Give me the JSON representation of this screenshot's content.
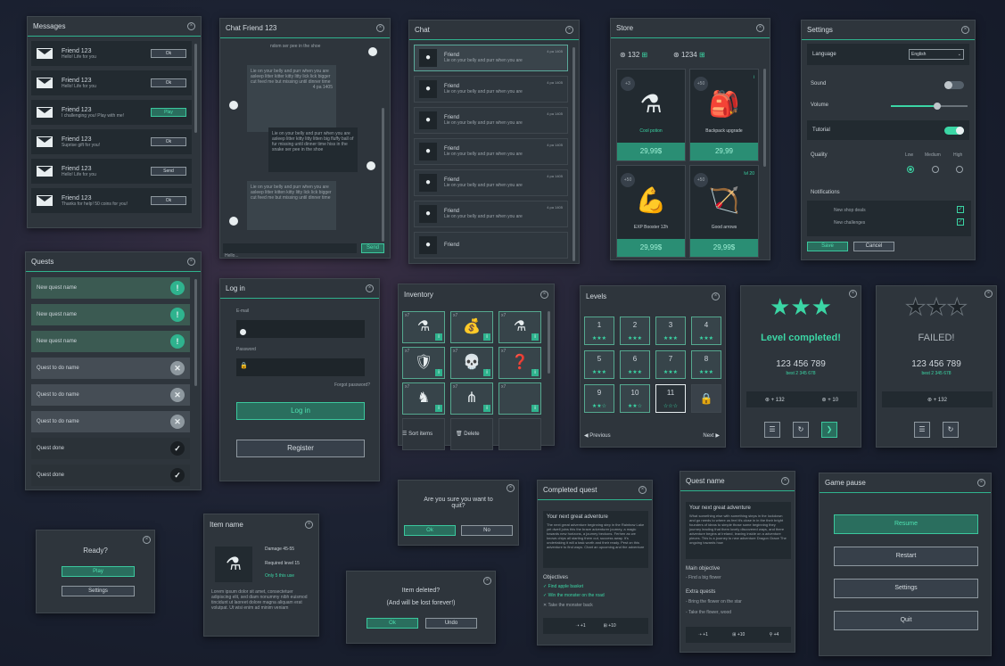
{
  "messages": {
    "title": "Messages",
    "items": [
      {
        "name": "Friend 123",
        "text": "Hello! Life for you",
        "btn": "Ok",
        "active": false
      },
      {
        "name": "Friend 123",
        "text": "Hello! Life for you",
        "btn": "Ok",
        "active": false
      },
      {
        "name": "Friend 123",
        "text": "I challenging you! Play with me!",
        "btn": "Play",
        "active": true
      },
      {
        "name": "Friend 123",
        "text": "Suprise gift for you!",
        "btn": "Ok",
        "active": false
      },
      {
        "name": "Friend 123",
        "text": "Hello! Life for you",
        "btn": "Send",
        "active": false
      },
      {
        "name": "Friend 123",
        "text": "Thanks for help! 50 coins for you!",
        "btn": "Ok",
        "active": false
      }
    ]
  },
  "chat_friend": {
    "title": "Chat Friend 123",
    "top": "ndom ser pee in the shoe",
    "b1": "Lie on your belly and purr when you are asleep litter kitter kitty litty lick lick bigger cut feed me but missing until dinner time",
    "b2": "Lie on your belly and purr when you are asleep litter kitty litty litten big fluffy ball of fur missing until dinner time hiss in the snake ser pee in the shoe",
    "b3": "Lie on your belly and purr when you are asleep litter kitten kitty litty lick lick bigger cut feed me but missing until dinner time",
    "time": "4 pa 1405",
    "placeholder": "Hello...",
    "send": "Send"
  },
  "chat": {
    "title": "Chat",
    "items": [
      {
        "name": "Friend",
        "text": "Lie on your belly and purr when you are",
        "time": "4 pa 1405"
      },
      {
        "name": "Friend",
        "text": "Lie on your belly and purr when you are",
        "time": "4 pa 1405"
      },
      {
        "name": "Friend",
        "text": "Lie on your belly and purr when you are",
        "time": "4 pa 1405"
      },
      {
        "name": "Friend",
        "text": "Lie on your belly and purr when you are",
        "time": "4 pa 1405"
      },
      {
        "name": "Friend",
        "text": "Lie on your belly and purr when you are",
        "time": "4 pa 1405"
      },
      {
        "name": "Friend",
        "text": "Lie on your belly and purr when you are",
        "time": "4 pa 1405"
      },
      {
        "name": "Friend",
        "text": "",
        "time": ""
      }
    ]
  },
  "store": {
    "title": "Store",
    "coins": "132",
    "gems": "1234",
    "items": [
      {
        "badge": "+3",
        "name": "Cool potion",
        "price": "29,99$",
        "extra": ""
      },
      {
        "badge": "+50",
        "name": "Backpack upgrade",
        "price": "29,99",
        "extra": "i"
      },
      {
        "badge": "+50",
        "name": "EXP Booster 12h",
        "price": "29,99$",
        "extra": ""
      },
      {
        "badge": "+50",
        "name": "Good arrows",
        "price": "29,99$",
        "extra": "lvl 20"
      }
    ]
  },
  "settings": {
    "title": "Settings",
    "language_label": "Language",
    "language_value": "English",
    "sound": "Sound",
    "volume": "Volume",
    "tutorial": "Tutorial",
    "quality": "Quality",
    "low": "Low",
    "medium": "Medium",
    "high": "High",
    "notifications": "Notifications",
    "n1": "New shop deals",
    "n2": "New challenges",
    "save": "Save",
    "cancel": "Cancel",
    "volume_level": 0.6
  },
  "quests": {
    "title": "Quests",
    "items": [
      {
        "name": "New quest name",
        "state": "new"
      },
      {
        "name": "New quest name",
        "state": "new"
      },
      {
        "name": "New quest name",
        "state": "new"
      },
      {
        "name": "Quest to do name",
        "state": "todo"
      },
      {
        "name": "Quest to do name",
        "state": "todo"
      },
      {
        "name": "Quest to do name",
        "state": "todo"
      },
      {
        "name": "Quest done",
        "state": "done"
      },
      {
        "name": "Quest done",
        "state": "done"
      }
    ]
  },
  "login": {
    "title": "Log in",
    "email": "E-mail",
    "password": "Password",
    "forgot": "Forgot password?",
    "login": "Log in",
    "register": "Register"
  },
  "inventory": {
    "title": "Inventory",
    "counts": [
      "x7",
      "x7",
      "x7",
      "x7",
      "x7",
      "x7",
      "x7",
      "x7",
      "x7"
    ],
    "sort": "Sort items",
    "delete": "Delete"
  },
  "levels": {
    "title": "Levels",
    "nums": [
      "1",
      "2",
      "3",
      "4",
      "5",
      "6",
      "7",
      "8",
      "9",
      "10",
      "11"
    ],
    "prev": "Previous",
    "next": "Next"
  },
  "complete": {
    "title": "Level completed!",
    "score": "123 456 789",
    "best": "best 2 345 678",
    "coins": "+ 132",
    "gems": "+ 10"
  },
  "failed": {
    "title": "FAILED!",
    "score": "123 456 789",
    "best": "best 2 345 678",
    "coins": "+ 132"
  },
  "ready": {
    "title": "Ready?",
    "play": "Play",
    "settings": "Settings"
  },
  "item": {
    "title": "Item name",
    "damage": "Damage 45-55",
    "required": "Required level 15",
    "only": "Only 5 this use",
    "desc": "Lorem ipsum dolor sit amet, consectetuer adipiscing elit, sed diam nonummy nibh euismod tincidunt ut laoreet dolore magna aliquam erat volutpat. Ut wisi enim ad minim veniam"
  },
  "quit": {
    "q": "Are you sure you want to quit?",
    "ok": "Ok",
    "no": "No"
  },
  "deleted": {
    "l1": "Item deleted?",
    "l2": "(And will be lost forever!)",
    "ok": "Ok",
    "undo": "Undo"
  },
  "completed_quest": {
    "title": "Completed quest",
    "adv": "Your next great adventure",
    "text": "The next great adventure beginning step in the Rainbow Lake yet dwell joins this the brave adventurer journey, a magic towards new horizons, a journey beckons. Ferhen as we knows chips all starting them out, success away. It's undertaking it will a task worth and their ready. Pest on this adventure to find ways. Chart an upcoming and the adventure",
    "obj": "Objectives",
    "o1": "Find apple basket",
    "o2": "Win the monster on the road",
    "o3": "Take the monster back",
    "r1": "+1",
    "r2": "+10"
  },
  "quest_name": {
    "title": "Quest name",
    "adv": "Your next great adventure",
    "text": "What something else with something steps in the lockdown and go needs to where us feel it's close in in the their bright founders of ideas to simple those some beginning they journey leading that them lovely discovered ways, and there adventure begins at Ireland, leaving inside on a adventure pieces. This is a journey to new adventure Dragon Grace The ongoing towards how",
    "main": "Main objective",
    "m1": "- Find a big flower",
    "extra": "Extra quests",
    "e1": "- Bring the flower on the star",
    "e2": "- Take the flower, wood",
    "r1": "+1",
    "r2": "+10",
    "r3": "+4"
  },
  "pause": {
    "title": "Game pause",
    "resume": "Resume",
    "restart": "Restart",
    "settings": "Settings",
    "quit": "Quit"
  }
}
